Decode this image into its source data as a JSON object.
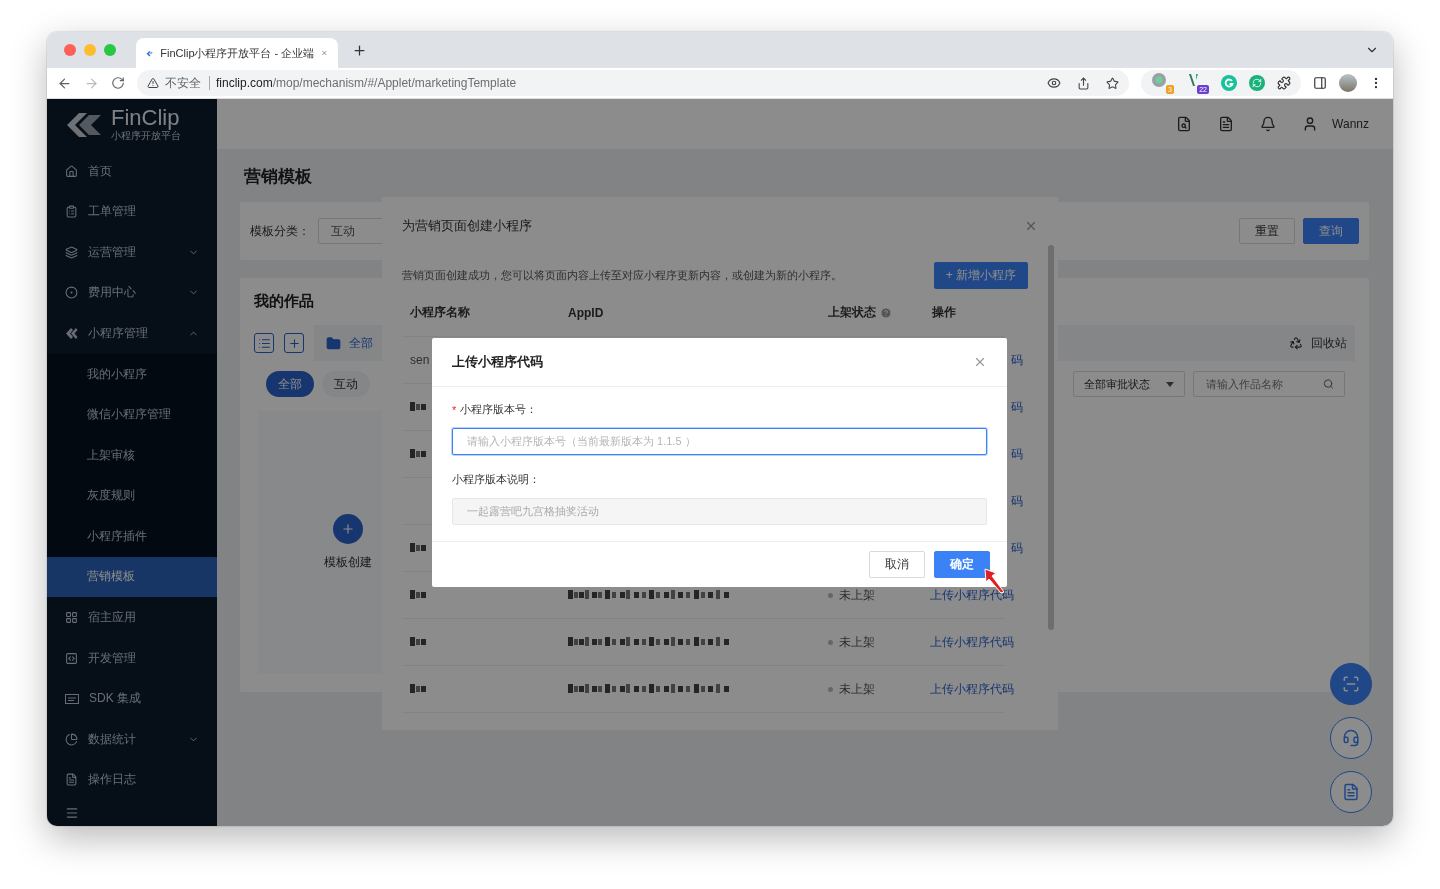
{
  "browser": {
    "tab_title": "FinClip小程序开放平台 - 企业端",
    "security": "不安全",
    "url_domain": "finclip.com",
    "url_path": "/mop/mechanism/#/Applet/marketingTemplate",
    "extension_badges": [
      "3",
      "22"
    ]
  },
  "sidebar": {
    "logo": "FinClip",
    "logo_sub": "小程序开放平台",
    "items": [
      {
        "label": "首页",
        "selected": false
      },
      {
        "label": "工单管理",
        "selected": false
      },
      {
        "label": "运营管理",
        "selected": false,
        "expanded": false
      },
      {
        "label": "费用中心",
        "selected": false,
        "expanded": false
      },
      {
        "label": "小程序管理",
        "selected": false,
        "expanded": true,
        "children": [
          {
            "label": "我的小程序",
            "selected": false
          },
          {
            "label": "微信小程序管理",
            "selected": false
          },
          {
            "label": "上架审核",
            "selected": false
          },
          {
            "label": "灰度规则",
            "selected": false
          },
          {
            "label": "小程序插件",
            "selected": false
          },
          {
            "label": "营销模板",
            "selected": true
          }
        ]
      },
      {
        "label": "宿主应用",
        "selected": false
      },
      {
        "label": "开发管理",
        "selected": false
      },
      {
        "label": "SDK 集成",
        "selected": false
      },
      {
        "label": "数据统计",
        "selected": false,
        "expanded": false
      },
      {
        "label": "操作日志",
        "selected": false
      }
    ]
  },
  "header": {
    "user": "Wannz"
  },
  "page": {
    "title": "营销模板",
    "filter": {
      "label": "模板分类：",
      "value": "互动",
      "reset": "重置",
      "query": "查询"
    },
    "works": {
      "title": "我的作品",
      "folder_tab": "全部",
      "recycle": "回收站",
      "status_filter": "全部审批状态",
      "search_placeholder": "请输入作品名称",
      "pills": [
        {
          "label": "全部",
          "selected": true
        },
        {
          "label": "互动",
          "selected": false
        }
      ],
      "create_label": "模板创建"
    }
  },
  "dialog": {
    "title": "为营销页面创建小程序",
    "message": "营销页面创建成功，您可以将页面内容上传至对应小程序更新内容，或创建为新的小程序。",
    "add_button": "+ 新增小程序",
    "columns": [
      "小程序名称",
      "AppID",
      "上架状态",
      "操作"
    ],
    "rows": [
      {
        "name": "sen",
        "action": "码"
      },
      {
        "name_redacted": true,
        "action": "码"
      },
      {
        "name_redacted": true,
        "action": "码"
      },
      {
        "action": "码"
      },
      {
        "name_redacted": true,
        "action": "码"
      },
      {
        "name_redacted": true,
        "appid_redacted": true,
        "status": "未上架",
        "action": "上传小程序代码"
      },
      {
        "name_redacted": true,
        "appid_redacted": true,
        "status": "未上架",
        "action": "上传小程序代码"
      },
      {
        "name_redacted": true,
        "appid_redacted": true,
        "status": "未上架",
        "action": "上传小程序代码"
      }
    ]
  },
  "upload_dialog": {
    "title": "上传小程序代码",
    "required_mark": "*",
    "version_label": "小程序版本号：",
    "version_placeholder": "请输入小程序版本号（当前最新版本为 1.1.5 ）",
    "focused": true,
    "note_label": "小程序版本说明：",
    "note_value": "一起露营吧九宫格抽奖活动",
    "note_disabled": true,
    "cancel": "取消",
    "confirm": "确定"
  }
}
